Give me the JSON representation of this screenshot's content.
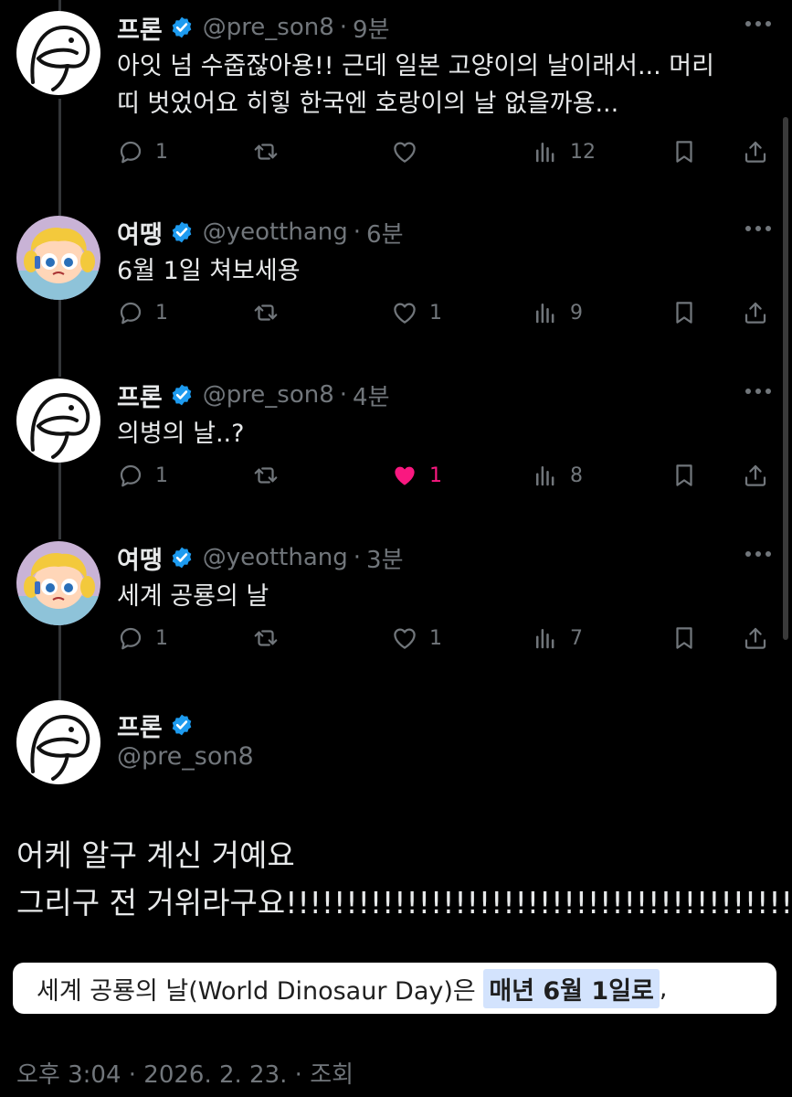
{
  "colors": {
    "background": "#000000",
    "text": "#e7e9ea",
    "secondary": "#71767b",
    "verified": "#1d9bf0",
    "like_active": "#f91880",
    "highlight": "#d3e3fd"
  },
  "replies": [
    {
      "name": "프론",
      "handle": "@pre_son8",
      "time": "9분",
      "avatar": "ghost-drawing-avatar",
      "text_lines": [
        "아잇 넘 수줍잖아용!! 근데 일본 고양이의 날이래서... 머리",
        "띠 벗었어요 히힣 한국엔 호랑이의 날 없을까용..."
      ],
      "replies": "1",
      "retweets": "",
      "likes": "",
      "liked": false,
      "views": "12"
    },
    {
      "name": "여땡",
      "handle": "@yeotthang",
      "time": "6분",
      "avatar": "cartoon-girl-avatar",
      "text_lines": [
        "6월 1일 쳐보세용"
      ],
      "replies": "1",
      "retweets": "",
      "likes": "1",
      "liked": false,
      "views": "9"
    },
    {
      "name": "프론",
      "handle": "@pre_son8",
      "time": "4분",
      "avatar": "ghost-drawing-avatar",
      "text_lines": [
        "의병의 날..?"
      ],
      "replies": "1",
      "retweets": "",
      "likes": "1",
      "liked": true,
      "views": "8"
    },
    {
      "name": "여땡",
      "handle": "@yeotthang",
      "time": "3분",
      "avatar": "cartoon-girl-avatar",
      "text_lines": [
        "세계 공룡의 날"
      ],
      "replies": "1",
      "retweets": "",
      "likes": "1",
      "liked": false,
      "views": "7"
    }
  ],
  "main": {
    "name": "프론",
    "handle": "@pre_son8",
    "text_lines": [
      "어케 알구 계신 거예요",
      "그리구 전 거위라구요!!!!!!!!!!!!!!!!!!!!!!!!!!!!!!!!!!!!!!!!!!!"
    ],
    "snippet": {
      "prefix": "세계 공룡의 날(World Dinosaur Day)은 ",
      "highlight": "매년 6월 1일로",
      "suffix": ","
    },
    "footer": "오후 3:04 · 2026. 2. 23. · 조회"
  }
}
